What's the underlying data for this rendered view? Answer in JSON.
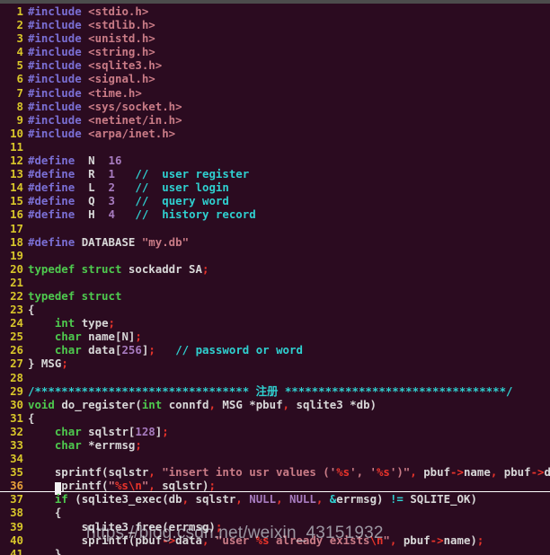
{
  "window": {
    "title_bar_color": "#4c4c4c",
    "background_color": "#2b0b20",
    "line_number_color": "#d8c62a",
    "cursor_line_number_color": "#e8a13a",
    "cursor_color": "#f2f2f2"
  },
  "watermark": {
    "text": "https://blog.csdn.net/weixin_43151932"
  },
  "editor": {
    "language": "C",
    "cursor": {
      "line": 36,
      "column": 5
    },
    "lines": [
      {
        "n": "1",
        "text": "#include <stdio.h>"
      },
      {
        "n": "2",
        "text": "#include <stdlib.h>"
      },
      {
        "n": "3",
        "text": "#include <unistd.h>"
      },
      {
        "n": "4",
        "text": "#include <string.h>"
      },
      {
        "n": "5",
        "text": "#include <sqlite3.h>"
      },
      {
        "n": "6",
        "text": "#include <signal.h>"
      },
      {
        "n": "7",
        "text": "#include <time.h>"
      },
      {
        "n": "8",
        "text": "#include <sys/socket.h>"
      },
      {
        "n": "9",
        "text": "#include <netinet/in.h>"
      },
      {
        "n": "10",
        "text": "#include <arpa/inet.h>"
      },
      {
        "n": "11",
        "text": ""
      },
      {
        "n": "12",
        "text": "#define  N  16"
      },
      {
        "n": "13",
        "text": "#define  R  1   //  user register"
      },
      {
        "n": "14",
        "text": "#define  L  2   //  user login"
      },
      {
        "n": "15",
        "text": "#define  Q  3   //  query word"
      },
      {
        "n": "16",
        "text": "#define  H  4   //  history record"
      },
      {
        "n": "17",
        "text": ""
      },
      {
        "n": "18",
        "text": "#define DATABASE \"my.db\""
      },
      {
        "n": "19",
        "text": ""
      },
      {
        "n": "20",
        "text": "typedef struct sockaddr SA;"
      },
      {
        "n": "21",
        "text": ""
      },
      {
        "n": "22",
        "text": "typedef struct"
      },
      {
        "n": "23",
        "text": "{"
      },
      {
        "n": "24",
        "text": "    int type;"
      },
      {
        "n": "25",
        "text": "    char name[N];"
      },
      {
        "n": "26",
        "text": "    char data[256];   // password or word"
      },
      {
        "n": "27",
        "text": "} MSG;"
      },
      {
        "n": "28",
        "text": ""
      },
      {
        "n": "29",
        "text": "/******************************** 注册 *********************************/"
      },
      {
        "n": "30",
        "text": "void do_register(int connfd, MSG *pbuf, sqlite3 *db)"
      },
      {
        "n": "31",
        "text": "{"
      },
      {
        "n": "32",
        "text": "    char sqlstr[128];"
      },
      {
        "n": "33",
        "text": "    char *errmsg;"
      },
      {
        "n": "34",
        "text": ""
      },
      {
        "n": "35",
        "text": "    sprintf(sqlstr, \"insert into usr values ('%s', '%s')\", pbuf->name, pbuf->data);"
      },
      {
        "n": "36",
        "text": "    printf(\"%s\\n\", sqlstr);"
      },
      {
        "n": "37",
        "text": "    if (sqlite3_exec(db, sqlstr, NULL, NULL, &errmsg) != SQLITE_OK)"
      },
      {
        "n": "38",
        "text": "    {"
      },
      {
        "n": "39",
        "text": "        sqlite3_free(errmsg);"
      },
      {
        "n": "40",
        "text": "        sprintf(pbuf->data, \"user %s already exists\\n\", pbuf->name);"
      },
      {
        "n": "41",
        "text": "    }"
      }
    ]
  }
}
